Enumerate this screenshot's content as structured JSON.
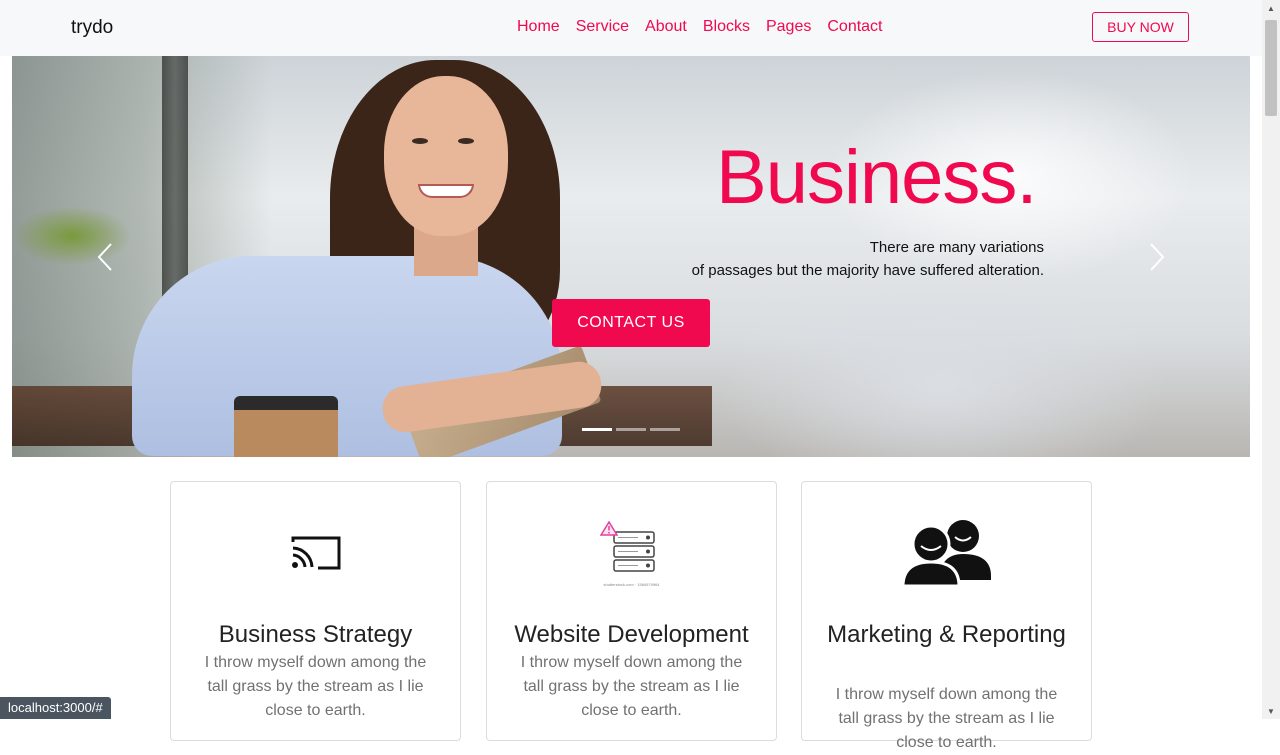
{
  "navbar": {
    "brand": "trydo",
    "links": [
      "Home",
      "Service",
      "About",
      "Blocks",
      "Pages",
      "Contact"
    ],
    "buy_label": "BUY NOW",
    "accent": "#f0094f"
  },
  "hero": {
    "title": "Business.",
    "subtitle_line1": "There are many variations",
    "subtitle_line2": "of passages but the majority have suffered alteration.",
    "cta_label": "CONTACT US",
    "slide_count": 3,
    "active_slide": 1
  },
  "cards": [
    {
      "icon": "cast-icon",
      "title": "Business Strategy",
      "text": "I throw myself down among the tall grass by the stream as I lie close to earth."
    },
    {
      "icon": "server-icon",
      "title": "Website Development",
      "text": "I throw myself down among the tall grass by the stream as I lie close to earth.",
      "icon_caption": "shutterstock.com · 1584979964"
    },
    {
      "icon": "users-icon",
      "title": "Marketing & Reporting",
      "text": "I throw myself down among the tall grass by the stream as I lie close to earth."
    }
  ],
  "status_bar": {
    "url": "localhost:3000/#"
  }
}
